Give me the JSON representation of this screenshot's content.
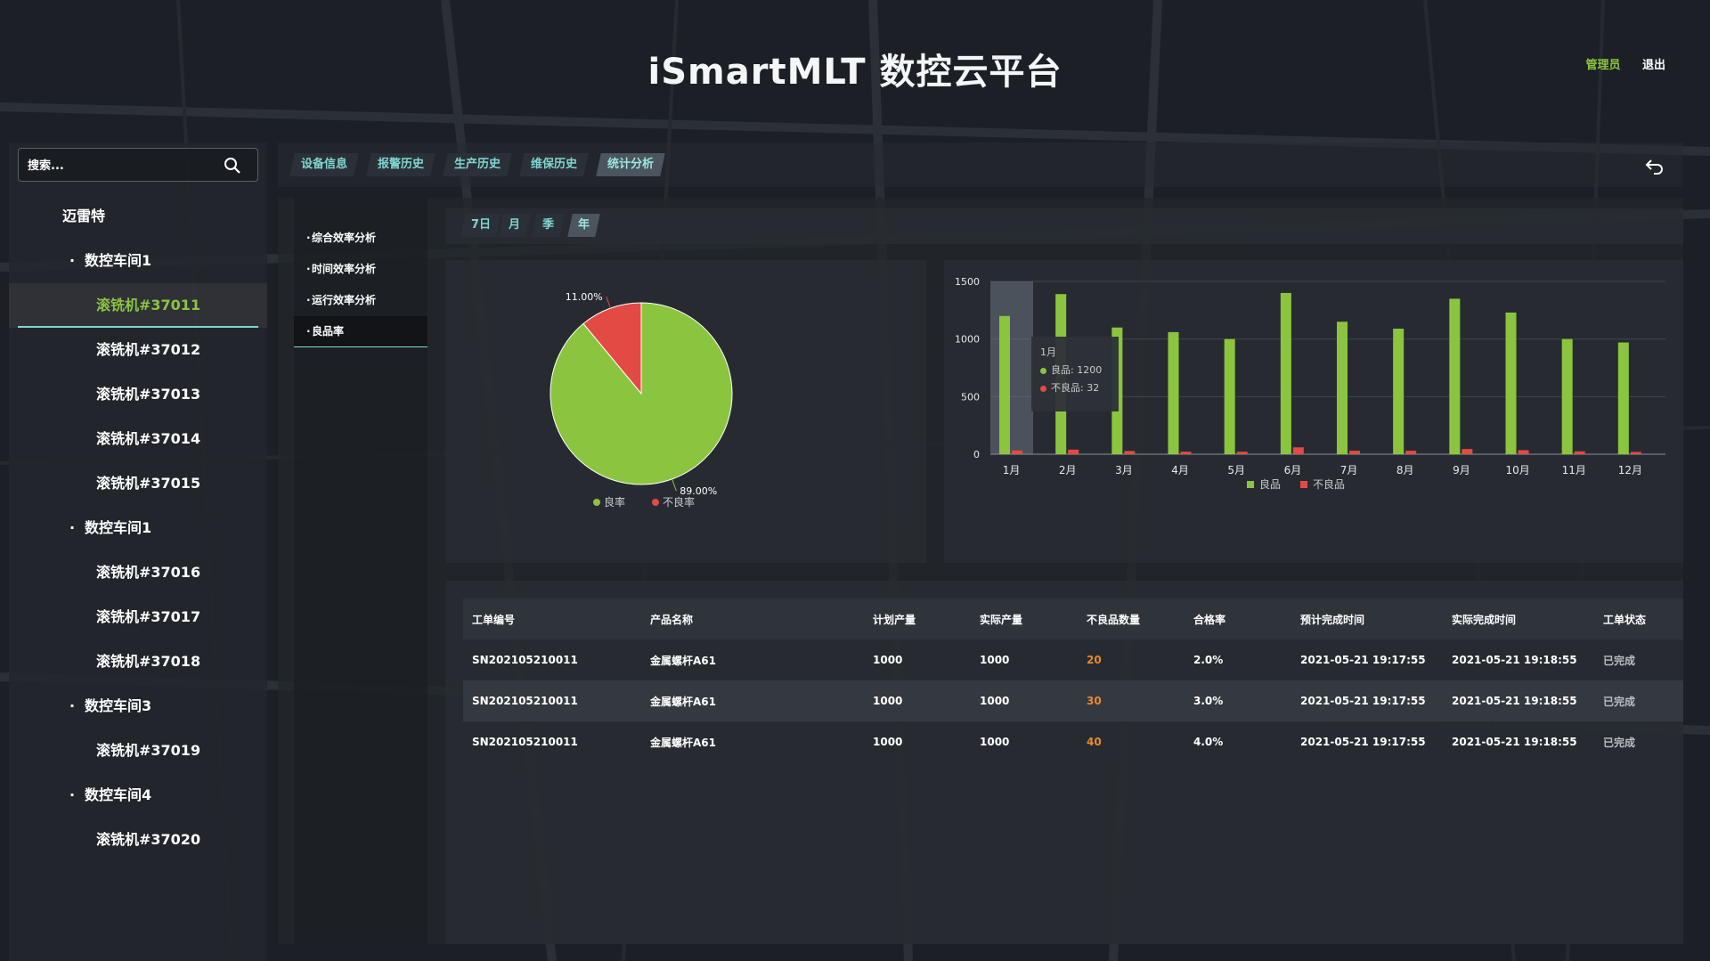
{
  "header": {
    "title": "iSmartMLT 数控云平台",
    "user": "管理员",
    "logout": "退出"
  },
  "search": {
    "placeholder": "搜索..."
  },
  "sidebar": {
    "root": "迈雷特",
    "items": [
      {
        "type": "group",
        "label": "数控车间1"
      },
      {
        "type": "leaf",
        "label": "滚铣机#37011",
        "active": true
      },
      {
        "type": "leaf",
        "label": "滚铣机#37012"
      },
      {
        "type": "leaf",
        "label": "滚铣机#37013"
      },
      {
        "type": "leaf",
        "label": "滚铣机#37014"
      },
      {
        "type": "leaf",
        "label": "滚铣机#37015"
      },
      {
        "type": "group",
        "label": "数控车间1"
      },
      {
        "type": "leaf",
        "label": "滚铣机#37016"
      },
      {
        "type": "leaf",
        "label": "滚铣机#37017"
      },
      {
        "type": "leaf",
        "label": "滚铣机#37018"
      },
      {
        "type": "group",
        "label": "数控车间3"
      },
      {
        "type": "leaf",
        "label": "滚铣机#37019"
      },
      {
        "type": "group",
        "label": "数控车间4"
      },
      {
        "type": "leaf",
        "label": "滚铣机#37020"
      }
    ]
  },
  "tabs": [
    {
      "label": "设备信息"
    },
    {
      "label": "报警历史"
    },
    {
      "label": "生产历史"
    },
    {
      "label": "维保历史"
    },
    {
      "label": "统计分析",
      "active": true
    }
  ],
  "analysis_menu": [
    {
      "label": "综合效率分析"
    },
    {
      "label": "时间效率分析"
    },
    {
      "label": "运行效率分析"
    },
    {
      "label": "良品率",
      "active": true
    }
  ],
  "period_tabs": [
    {
      "label": "7日"
    },
    {
      "label": "月"
    },
    {
      "label": "季"
    },
    {
      "label": "年",
      "active": true
    }
  ],
  "colors": {
    "good": "#8bc53f",
    "bad": "#e24b43",
    "accent": "#7fd5d1",
    "warn": "#e88a2c"
  },
  "tooltip": {
    "title": "1月",
    "good": "良品: 1200",
    "bad": "不良品: 32"
  },
  "chart_data": [
    {
      "type": "pie",
      "categories": [
        "良率",
        "不良率"
      ],
      "values": [
        89.0,
        11.0
      ],
      "labels": [
        "89.00%",
        "11.00%"
      ],
      "legend": "bottom"
    },
    {
      "type": "bar",
      "categories": [
        "1月",
        "2月",
        "3月",
        "4月",
        "5月",
        "6月",
        "7月",
        "8月",
        "9月",
        "10月",
        "11月",
        "12月"
      ],
      "series": [
        {
          "name": "良品",
          "values": [
            1200,
            1390,
            1100,
            1060,
            1000,
            1400,
            1150,
            1090,
            1350,
            1230,
            1000,
            970
          ]
        },
        {
          "name": "不良品",
          "values": [
            32,
            40,
            28,
            22,
            22,
            60,
            30,
            30,
            45,
            35,
            25,
            20
          ]
        }
      ],
      "yticks": [
        0,
        500,
        1000,
        1500
      ],
      "ylim": [
        0,
        1500
      ],
      "grid": true,
      "legend": "bottom"
    }
  ],
  "table": {
    "headers": [
      "工单编号",
      "产品名称",
      "计划产量",
      "实际产量",
      "不良品数量",
      "合格率",
      "预计完成时间",
      "实际完成时间",
      "工单状态"
    ],
    "rows": [
      [
        "SN202105210011",
        "金属螺杆A61",
        "1000",
        "1000",
        "20",
        "2.0%",
        "2021-05-21 19:17:55",
        "2021-05-21 19:18:55",
        "已完成"
      ],
      [
        "SN202105210011",
        "金属螺杆A61",
        "1000",
        "1000",
        "30",
        "3.0%",
        "2021-05-21 19:17:55",
        "2021-05-21 19:18:55",
        "已完成"
      ],
      [
        "SN202105210011",
        "金属螺杆A61",
        "1000",
        "1000",
        "40",
        "4.0%",
        "2021-05-21 19:17:55",
        "2021-05-21 19:18:55",
        "已完成"
      ]
    ]
  }
}
